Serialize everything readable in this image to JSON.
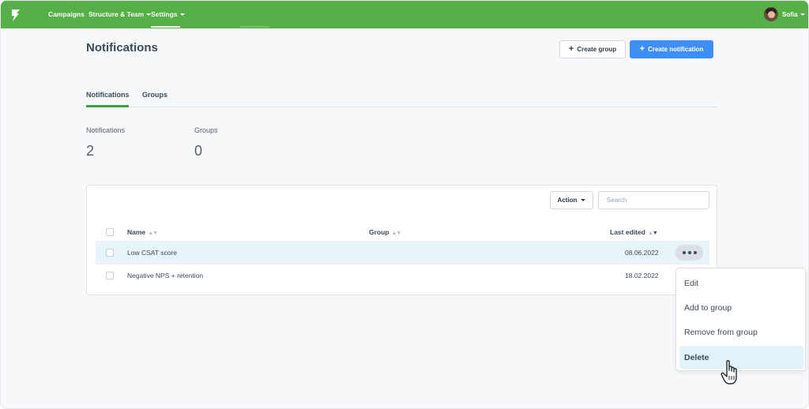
{
  "nav": {
    "items": [
      {
        "label": "Campaigns"
      },
      {
        "label": "Structure & Team"
      },
      {
        "label": "Settings"
      }
    ],
    "user_name": "Sofia"
  },
  "header": {
    "title": "Notifications",
    "create_group_label": "Create group",
    "create_notification_label": "Create notification"
  },
  "tabs": [
    {
      "label": "Notifications",
      "active": true
    },
    {
      "label": "Groups",
      "active": false
    }
  ],
  "stats": [
    {
      "label": "Notifications",
      "value": "2"
    },
    {
      "label": "Groups",
      "value": "0"
    }
  ],
  "table": {
    "action_label": "Action",
    "search_placeholder": "Search",
    "columns": [
      "Name",
      "Group",
      "Last edited"
    ],
    "rows": [
      {
        "name": "Low CSAT score",
        "group": "",
        "last_edited": "08.06.2022",
        "highlighted": true
      },
      {
        "name": "Negative NPS + retention",
        "group": "",
        "last_edited": "18.02.2022",
        "highlighted": false
      }
    ]
  },
  "context_menu": {
    "items": [
      {
        "label": "Edit"
      },
      {
        "label": "Add to group"
      },
      {
        "label": "Remove from group"
      },
      {
        "label": "Delete",
        "hovered": true
      }
    ]
  },
  "colors": {
    "topbar": "#55b047",
    "primary_button": "#3e8ef7",
    "active_tab": "#3aa141",
    "row_highlight": "#e7f5fb"
  },
  "icons": [
    "app-logo-icon",
    "plus-icon",
    "caret-down-icon",
    "sort-icon",
    "more-dots-icon",
    "hand-pointer-icon"
  ]
}
